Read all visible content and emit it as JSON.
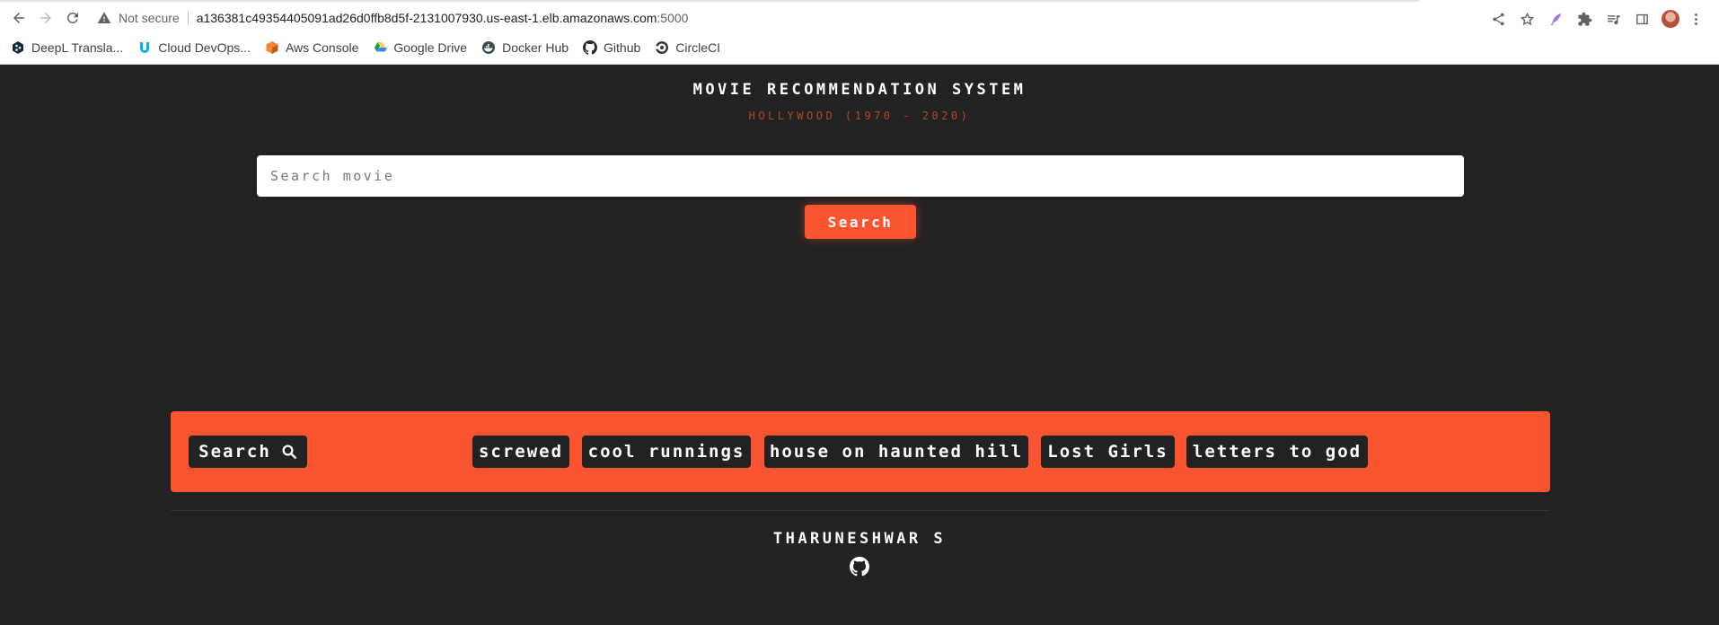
{
  "browser": {
    "security_label": "Not secure",
    "url_host": "a136381c49354405091ad26d0ffb8d5f-2131007930.us-east-1.elb.amazonaws.com",
    "url_port": ":5000",
    "bookmarks": [
      {
        "label": "DeepL Transla...",
        "icon": "deepl-icon"
      },
      {
        "label": "Cloud DevOps...",
        "icon": "udacity-icon"
      },
      {
        "label": "Aws Console",
        "icon": "aws-icon"
      },
      {
        "label": "Google Drive",
        "icon": "google-drive-icon"
      },
      {
        "label": "Docker Hub",
        "icon": "docker-icon"
      },
      {
        "label": "Github",
        "icon": "github-icon"
      },
      {
        "label": "CircleCI",
        "icon": "circleci-icon"
      }
    ]
  },
  "header": {
    "title": "MOVIE RECOMMENDATION SYSTEM",
    "subtitle": "HOLLYWOOD (1970 - 2020)"
  },
  "search": {
    "placeholder": "Search movie",
    "button_label": "Search"
  },
  "suggestions": {
    "label": "Search",
    "items": [
      "screwed",
      "cool runnings",
      "house on haunted hill",
      "Lost Girls",
      "letters to god"
    ]
  },
  "footer": {
    "author": "THARUNESHWAR S"
  },
  "colors": {
    "accent": "#fa5530",
    "background": "#222222",
    "subtitle": "#b5462a"
  }
}
